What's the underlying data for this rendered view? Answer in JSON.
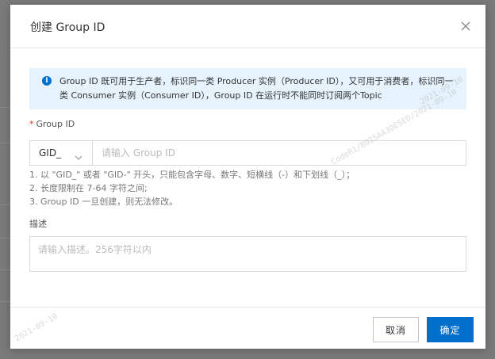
{
  "dialog": {
    "title": "创建 Group ID",
    "close_icon": "close-icon"
  },
  "info": {
    "icon": "info-icon",
    "text": "Group ID 既可用于生产者，标识同一类 Producer 实例（Producer ID），又可用于消费者，标识同一类 Consumer 实例（Consumer ID），Group ID 在运行时不能同时订阅两个Topic"
  },
  "form": {
    "group_id": {
      "required_mark": "*",
      "label": "Group ID",
      "prefix_selected": "GID_",
      "placeholder": "请输入 Group ID",
      "value": "",
      "rules": [
        "1. 以 \"GID_\" 或者 \"GID-\" 开头，只能包含字母、数字、短横线（-）和下划线（_）；",
        "2. 长度限制在 7-64 字符之间;",
        "3. Group ID 一旦创建，则无法修改。"
      ]
    },
    "description": {
      "label": "描述",
      "placeholder": "请输入描述。256字符以内",
      "value": ""
    }
  },
  "footer": {
    "cancel_label": "取消",
    "ok_label": "确定"
  },
  "watermarks": [
    "2021-09-10",
    "CodeR1/B025AA3DE5ED/2021-09-10",
    "2021-09-10"
  ],
  "colors": {
    "primary": "#0070cc",
    "info_bg": "#e6f3fd",
    "required": "#d93026"
  }
}
